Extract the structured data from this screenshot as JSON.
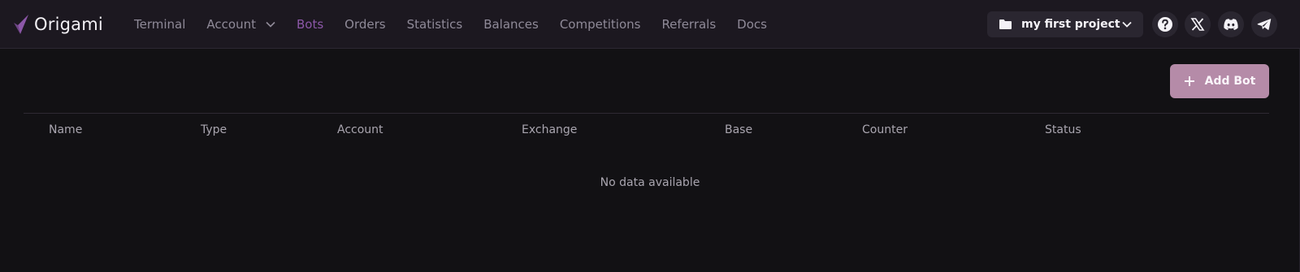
{
  "app": {
    "logo_text": "Origami"
  },
  "nav": {
    "items": [
      {
        "label": "Terminal"
      },
      {
        "label": "Account"
      },
      {
        "label": "Bots"
      },
      {
        "label": "Orders"
      },
      {
        "label": "Statistics"
      },
      {
        "label": "Balances"
      },
      {
        "label": "Competitions"
      },
      {
        "label": "Referrals"
      },
      {
        "label": "Docs"
      }
    ],
    "active": "Bots"
  },
  "project_selector": {
    "value": "my first project"
  },
  "header_icons": [
    "help-icon",
    "x-twitter-icon",
    "discord-icon",
    "telegram-icon"
  ],
  "toolbar": {
    "add_bot_label": "Add Bot"
  },
  "table": {
    "columns": [
      "Name",
      "Type",
      "Account",
      "Exchange",
      "Base",
      "Counter",
      "Status"
    ],
    "rows": [],
    "empty_text": "No data available"
  },
  "colors": {
    "background": "#121114",
    "topbar": "#1c1820",
    "accent_active": "#8c57a8",
    "add_button": "#b58ba8"
  }
}
